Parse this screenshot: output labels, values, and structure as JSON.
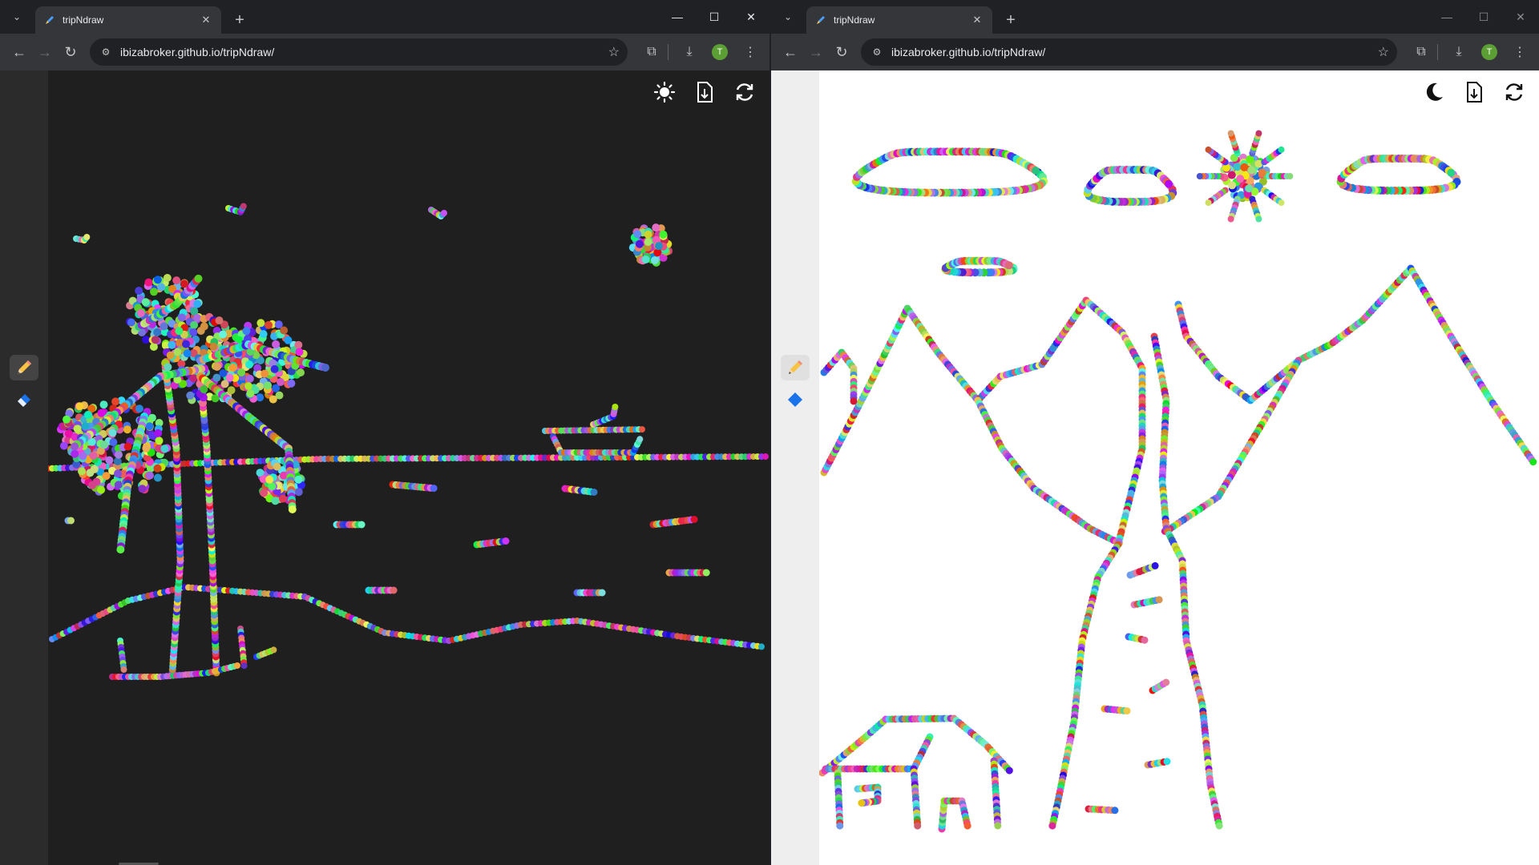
{
  "windows": [
    {
      "id": "left",
      "theme": "dark",
      "tab_title": "tripNdraw",
      "url": "ibizabroker.github.io/tripNdraw/",
      "avatar_letter": "T",
      "theme_toggle_icon": "sun-icon"
    },
    {
      "id": "right",
      "theme": "light",
      "tab_title": "tripNdraw",
      "url": "ibizabroker.github.io/tripNdraw/",
      "avatar_letter": "T",
      "theme_toggle_icon": "moon-icon"
    }
  ],
  "tools": {
    "pencil": "pencil-icon",
    "eraser": "eraser-icon",
    "active_tool": "pencil"
  },
  "actions": {
    "download": "download-file-icon",
    "reset": "refresh-icon"
  },
  "colors": {
    "dark_canvas": "#1f1f1f",
    "dark_side_panel": "#2b2b2b",
    "light_canvas": "#ffffff",
    "light_side_panel": "#eeeeee",
    "avatar": "#5c9f34",
    "eraser_blue": "#1a73e8",
    "pencil_yellow": "#f6c343"
  },
  "drawings": {
    "left": "palm tree beach scene with boat, moon and birds",
    "right": "mountains, river, clouds, sun and house"
  }
}
